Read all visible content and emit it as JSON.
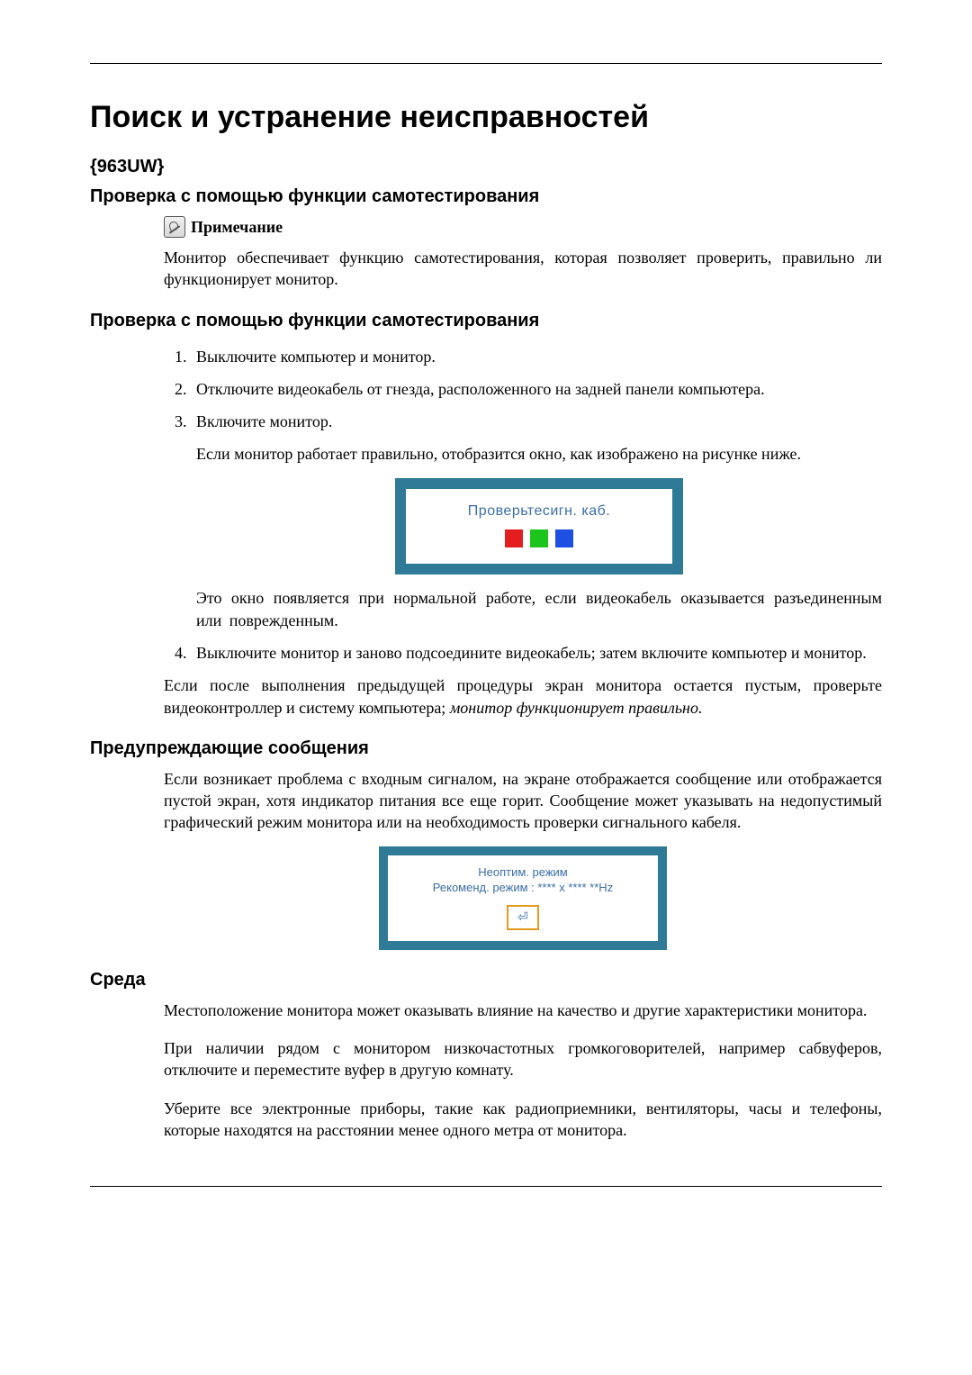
{
  "page": {
    "title": "Поиск и устранение неисправностей",
    "model": "{963UW}"
  },
  "sections": {
    "selftest_title": "Проверка с помощью функции самотестирования",
    "note_label": "Примечание",
    "note_text": "Монитор обеспечивает функцию самотестирования, которая позволяет проверить, правильно ли функционирует монитор.",
    "selftest_title2": "Проверка с помощью функции самотестирования",
    "steps": [
      "Выключите компьютер и монитор.",
      "Отключите видеокабель от гнезда, расположенного на задней панели компьютера.",
      "Включите монитор."
    ],
    "step3_after": "Если монитор работает правильно, отобразится окно, как изображено на рисунке ниже.",
    "osd1_text": "Проверьтесигн. каб.",
    "step3_after2": "Это окно появляется при нормальной работе, если видеокабель оказывается разъединенным или поврежденным.",
    "step4": "Выключите монитор и заново подсоедините видеокабель; затем включите компьютер и монитор.",
    "after_list": "Если после выполнения предыдущей процедуры экран монитора остается пустым, проверьте видеоконтроллер и систему компьютера; ",
    "after_list_italic": "монитор функционирует правильно.",
    "warn_title": "Предупреждающие сообщения",
    "warn_text": "Если возникает проблема с входным сигналом, на экране отображается сообщение или отображается пустой экран, хотя индикатор питания все еще горит. Сообщение может указывать на недопустимый графический режим монитора или на необходимость проверки сигнального кабеля.",
    "osd2_line1": "Неоптим. режим",
    "osd2_line2": "Рекоменд. режим :   **** x ****   **Hz",
    "osd2_button": "⏎",
    "env_title": "Среда",
    "env_p1": "Местоположение монитора может оказывать влияние на качество и другие характеристики монитора.",
    "env_p2": "При наличии рядом с монитором низкочастотных громкоговорителей, например сабвуферов, отключите и переместите вуфер в другую комнату.",
    "env_p3": "Уберите все электронные приборы, такие как радиоприемники, вентиляторы, часы и телефоны, которые находятся на расстоянии менее одного метра от монитора."
  }
}
